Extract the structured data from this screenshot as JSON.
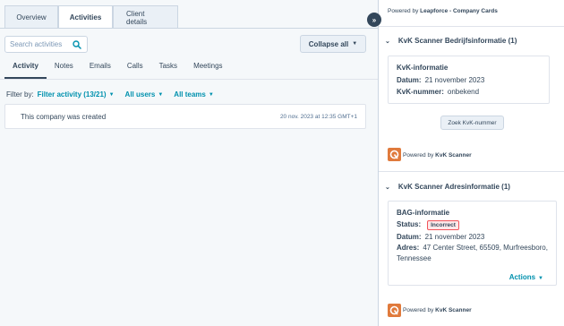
{
  "left": {
    "top_tabs": [
      {
        "label": "Overview"
      },
      {
        "label": "Activities"
      },
      {
        "label": "Client details"
      }
    ],
    "search": {
      "placeholder": "Search activities"
    },
    "collapse_label": "Collapse all",
    "sub_tabs": [
      "Activity",
      "Notes",
      "Emails",
      "Calls",
      "Tasks",
      "Meetings"
    ],
    "filter": {
      "label": "Filter by:",
      "activity": "Filter activity (13/21)",
      "users": "All users",
      "teams": "All teams"
    },
    "activity": {
      "text": "This company was created",
      "timestamp": "20 nov. 2023 at 12:35 GMT+1"
    }
  },
  "right": {
    "powered_top": {
      "prefix": "Powered by ",
      "brand": "Leapforce - Company Cards"
    },
    "section1": {
      "title": "KvK Scanner Bedrijfsinformatie (1)",
      "card_title": "KvK-informatie",
      "datum_label": "Datum:",
      "datum_value": "21 november 2023",
      "kvk_label": "KvK-nummer:",
      "kvk_value": "onbekend",
      "button": "Zoek KvK-nummer"
    },
    "powered_kvk": {
      "prefix": "Powered by ",
      "brand": "KvK Scanner"
    },
    "section2": {
      "title": "KvK Scanner Adresinformatie (1)",
      "card_title": "BAG-informatie",
      "status_label": "Status:",
      "status_value": "Incorrect",
      "datum_label": "Datum:",
      "datum_value": "21 november 2023",
      "adres_label": "Adres:",
      "adres_line1": "47 Center Street, 65509, Murfreesboro,",
      "adres_line2": "Tennessee",
      "actions": "Actions"
    },
    "powered_kvk2": {
      "prefix": "Powered by ",
      "brand": "KvK Scanner"
    }
  },
  "colors": {
    "accent": "#0091ae",
    "text": "#33475b",
    "logo": "#e07a3c",
    "badge_border": "#f2545b"
  }
}
